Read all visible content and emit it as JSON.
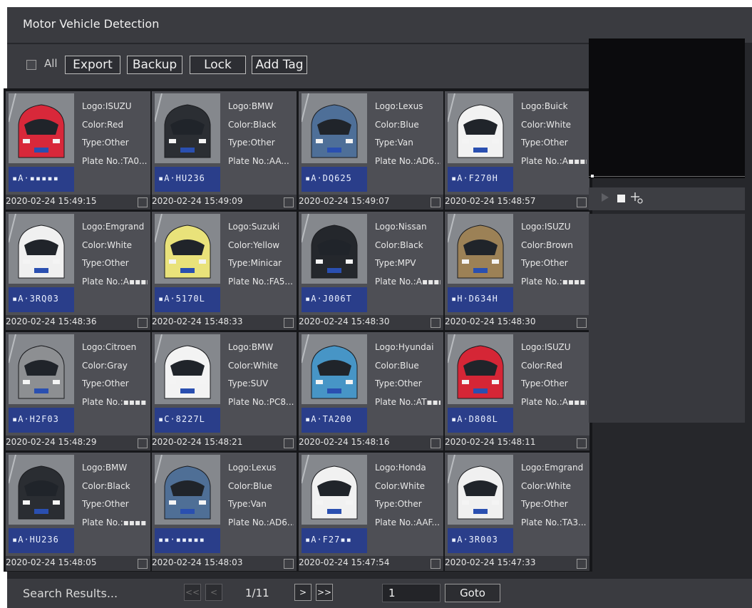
{
  "window": {
    "title": "Motor Vehicle Detection"
  },
  "toolbar": {
    "all_label": "All",
    "export_label": "Export",
    "backup_label": "Backup",
    "lock_label": "Lock",
    "add_tag_label": "Add Tag"
  },
  "cards": [
    {
      "logo": "Logo:ISUZU",
      "color": "Color:Red",
      "type": "Type:Other",
      "plate": "Plate No.:TA0...",
      "time": "2020-02-24 15:49:15",
      "plate_img": "▪A·▪▪▪▪▪",
      "car_color": "#d8283a"
    },
    {
      "logo": "Logo:BMW",
      "color": "Color:Black",
      "type": "Type:Other",
      "plate": "Plate No.:AA...",
      "time": "2020-02-24 15:49:09",
      "plate_img": "▪A·HU236",
      "car_color": "#2b2e33"
    },
    {
      "logo": "Logo:Lexus",
      "color": "Color:Blue",
      "type": "Type:Van",
      "plate": "Plate No.:AD6...",
      "time": "2020-02-24 15:49:07",
      "plate_img": "▪A·DQ625",
      "car_color": "#4e6f98"
    },
    {
      "logo": "Logo:Buick",
      "color": "Color:White",
      "type": "Type:Other",
      "plate": "Plate No.:A▪▪▪▪",
      "time": "2020-02-24 15:48:57",
      "plate_img": "▪A·F270H",
      "car_color": "#f2f2f2"
    },
    {
      "logo": "Logo:Emgrand",
      "color": "Color:White",
      "type": "Type:Other",
      "plate": "Plate No.:A▪▪▪▪",
      "time": "2020-02-24 15:48:36",
      "plate_img": "▪A·3RQ03",
      "car_color": "#f0f0f0"
    },
    {
      "logo": "Logo:Suzuki",
      "color": "Color:Yellow",
      "type": "Type:Minicar",
      "plate": "Plate No.:FA5...",
      "time": "2020-02-24 15:48:33",
      "plate_img": "▪A·5170L",
      "car_color": "#e9e27a"
    },
    {
      "logo": "Logo:Nissan",
      "color": "Color:Black",
      "type": "Type:MPV",
      "plate": "Plate No.:A▪▪▪▪",
      "time": "2020-02-24 15:48:30",
      "plate_img": "▪A·J006T",
      "car_color": "#24272c"
    },
    {
      "logo": "Logo:ISUZU",
      "color": "Color:Brown",
      "type": "Type:Other",
      "plate": "Plate No.:▪▪▪▪",
      "time": "2020-02-24 15:48:30",
      "plate_img": "▪H·D634H",
      "car_color": "#9c8156"
    },
    {
      "logo": "Logo:Citroen",
      "color": "Color:Gray",
      "type": "Type:Other",
      "plate": "Plate No.:▪▪▪▪",
      "time": "2020-02-24 15:48:29",
      "plate_img": "▪A·H2F03",
      "car_color": "#8d8f92"
    },
    {
      "logo": "Logo:BMW",
      "color": "Color:White",
      "type": "Type:SUV",
      "plate": "Plate No.:PC8...",
      "time": "2020-02-24 15:48:21",
      "plate_img": "▪C·8227L",
      "car_color": "#f3f3f3"
    },
    {
      "logo": "Logo:Hyundai",
      "color": "Color:Blue",
      "type": "Type:Other",
      "plate": "Plate No.:AT▪▪▪",
      "time": "2020-02-24 15:48:16",
      "plate_img": "▪A·TA200",
      "car_color": "#4795c6"
    },
    {
      "logo": "Logo:ISUZU",
      "color": "Color:Red",
      "type": "Type:Other",
      "plate": "Plate No.:A▪▪▪▪",
      "time": "2020-02-24 15:48:11",
      "plate_img": "▪A·D808L",
      "car_color": "#d52636"
    },
    {
      "logo": "Logo:BMW",
      "color": "Color:Black",
      "type": "Type:Other",
      "plate": "Plate No.:▪▪▪▪",
      "time": "2020-02-24 15:48:05",
      "plate_img": "▪A·HU236",
      "car_color": "#2a2d32"
    },
    {
      "logo": "Logo:Lexus",
      "color": "Color:Blue",
      "type": "Type:Van",
      "plate": "Plate No.:AD6...",
      "time": "2020-02-24 15:48:03",
      "plate_img": "▪▪·▪▪▪▪▪",
      "car_color": "#4f6f96"
    },
    {
      "logo": "Logo:Honda",
      "color": "Color:White",
      "type": "Type:Other",
      "plate": "Plate No.:AAF...",
      "time": "2020-02-24 15:47:54",
      "plate_img": "▪A·F27▪▪",
      "car_color": "#f1f1f1"
    },
    {
      "logo": "Logo:Emgrand",
      "color": "Color:White",
      "type": "Type:Other",
      "plate": "Plate No.:TA3...",
      "time": "2020-02-24 15:47:33",
      "plate_img": "▪A·3R003",
      "car_color": "#f0f0f0"
    }
  ],
  "player": {
    "play_icon": "play-icon",
    "stop_icon": "stop-icon",
    "snap_icon": "snap-icon"
  },
  "pagination": {
    "search_results_label": "Search Results...",
    "first_label": "<<",
    "prev_label": "<",
    "page_indicator": "1/11",
    "next_label": ">",
    "last_label": ">>",
    "goto_value": "1",
    "goto_label": "Goto"
  },
  "colors": {
    "panel": "#3a3b40",
    "card": "#4e4f55",
    "background": "#16171a"
  }
}
